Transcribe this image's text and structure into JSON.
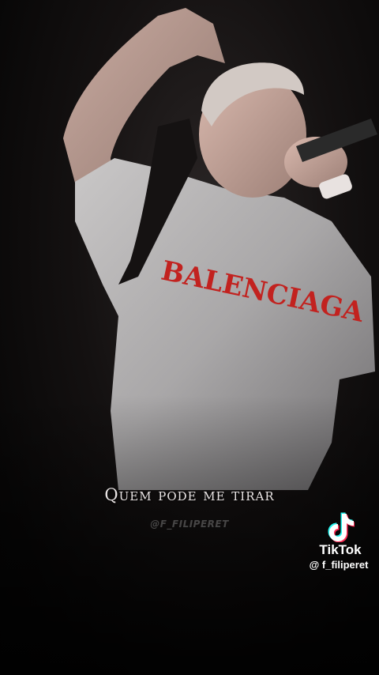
{
  "video": {
    "shirt_text": "BALENCIAGA",
    "caption": "Quem pode me tirar",
    "watermark": "@F_FILIPERET"
  },
  "tiktok": {
    "logo_icon": "tiktok-logo-icon",
    "brand": "TikTok",
    "username": "@ f_filiperet"
  }
}
